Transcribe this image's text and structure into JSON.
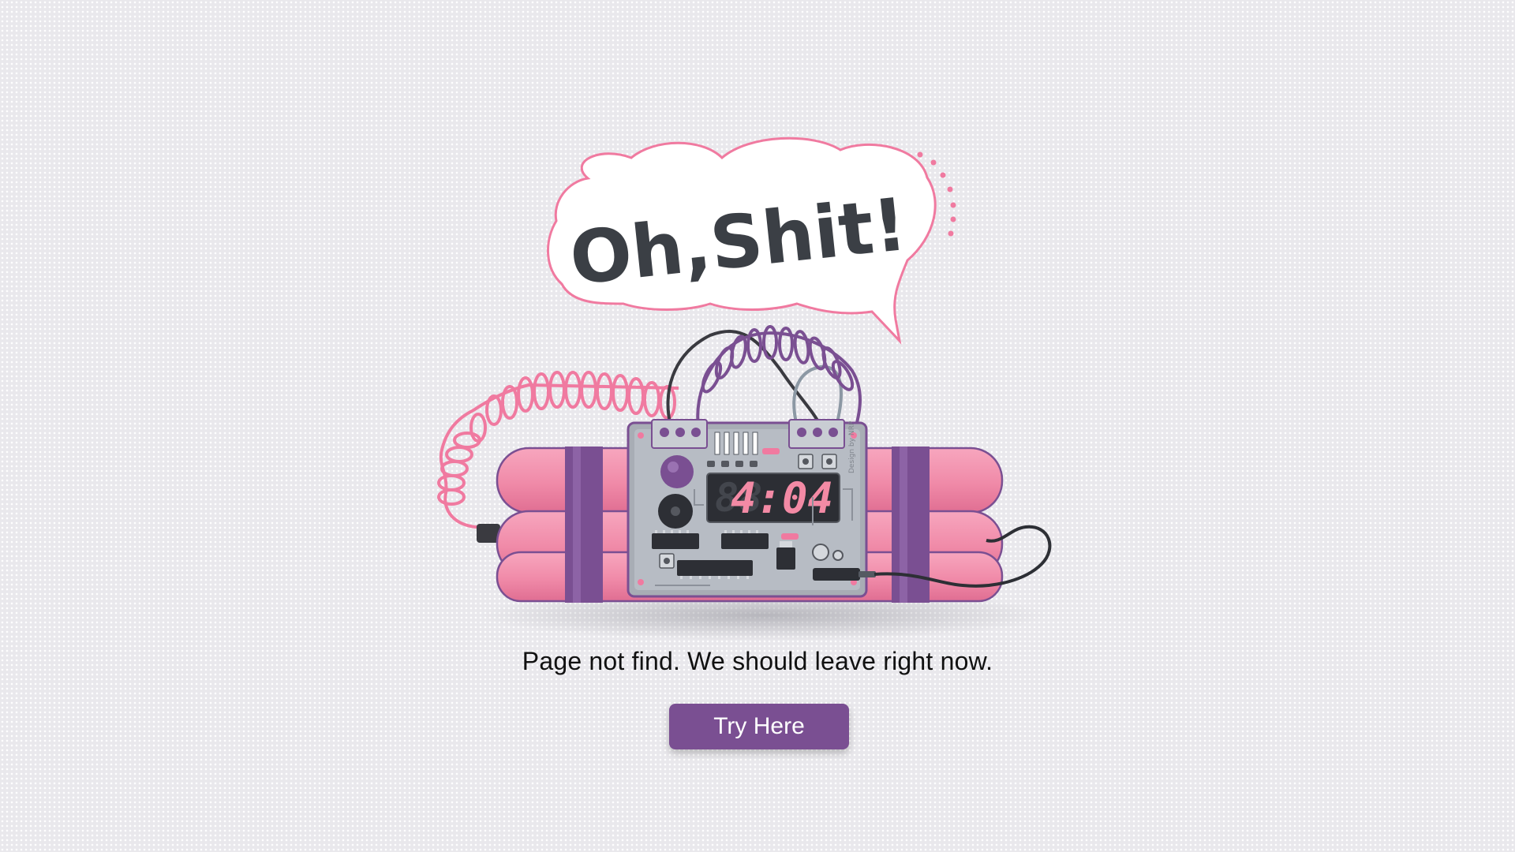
{
  "speech_bubble": {
    "text": "Oh,Shit!"
  },
  "bomb": {
    "timer_display": "4:04",
    "ghost_digits": "88",
    "board_label": "Design by NRP"
  },
  "message": "Page not find. We should leave right now.",
  "cta_button": {
    "label": "Try Here"
  },
  "colors": {
    "accent": "#7a4f92",
    "dynamite_pink": "#f08aa8",
    "bubble_outline": "#f07aa0",
    "background": "#e9e8ec",
    "lcd_digits": "#f38aa5"
  }
}
